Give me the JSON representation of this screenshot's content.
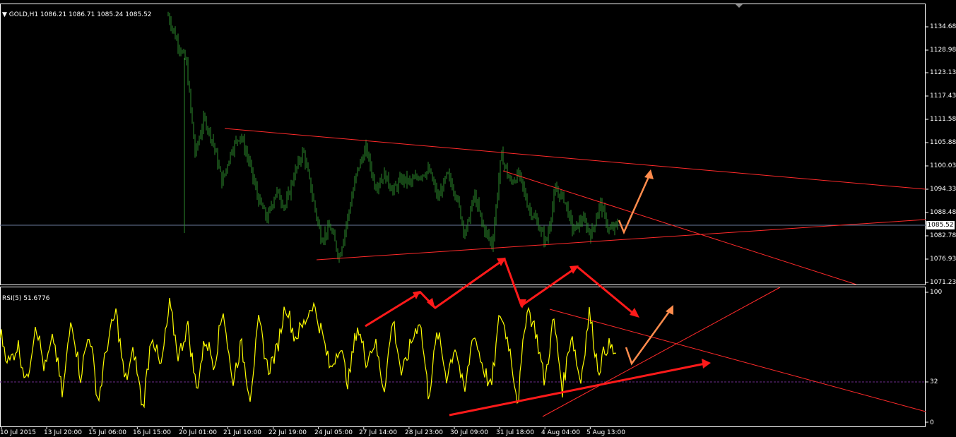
{
  "chart_header": {
    "symbol_caret": "▼",
    "symbol": "GOLD,H1",
    "ohlc": "1086.21 1086.71 1085.24 1085.52"
  },
  "rsi_header": {
    "label": "RSI(5) 51.6776"
  },
  "current_price": "1085.52",
  "price_axis": [
    "1134.68",
    "1128.98",
    "1123.13",
    "1117.43",
    "1111.58",
    "1105.88",
    "1100.03",
    "1094.33",
    "1088.48",
    "1082.78",
    "1076.93",
    "1071.23"
  ],
  "rsi_axis": [
    "100",
    "32",
    "0"
  ],
  "time_axis": [
    "10 Jul 2015",
    "13 Jul 20:00",
    "15 Jul 06:00",
    "16 Jul 15:00",
    "20 Jul 01:00",
    "21 Jul 10:00",
    "22 Jul 19:00",
    "24 Jul 05:00",
    "27 Jul 14:00",
    "28 Jul 23:00",
    "30 Jul 09:00",
    "31 Jul 18:00",
    "4 Aug 04:00",
    "5 Aug 13:00"
  ],
  "colors": {
    "background": "#000000",
    "frame": "#ffffff",
    "candle": "#2d8a2d",
    "trendline": "#ff2a2a",
    "arrow_red": "#ff1a1a",
    "arrow_orange": "#ff8c4d",
    "rsi_line": "#ffff00",
    "rsi_level": "#6b2d8a"
  },
  "chart_data": [
    {
      "type": "candlestick",
      "title": "GOLD,H1",
      "ylim": [
        1071.23,
        1137.5
      ],
      "x": [
        "10 Jul 2015",
        "13 Jul 20:00",
        "15 Jul 06:00",
        "16 Jul 15:00",
        "20 Jul 01:00",
        "21 Jul 10:00",
        "22 Jul 19:00",
        "24 Jul 05:00",
        "27 Jul 14:00",
        "28 Jul 23:00",
        "30 Jul 09:00",
        "31 Jul 18:00",
        "4 Aug 04:00",
        "5 Aug 13:00"
      ],
      "close_trace": [
        [
          0,
          1137.5
        ],
        [
          1,
          1131.0
        ],
        [
          2,
          1126.0
        ],
        [
          3,
          1103.0
        ],
        [
          4,
          1112.0
        ],
        [
          5,
          1106.0
        ],
        [
          6,
          1096.0
        ],
        [
          7,
          1104.0
        ],
        [
          8,
          1108.0
        ],
        [
          9,
          1101.0
        ],
        [
          10,
          1092.0
        ],
        [
          11,
          1087.0
        ],
        [
          12,
          1094.0
        ],
        [
          13,
          1090.0
        ],
        [
          14,
          1098.0
        ],
        [
          15,
          1104.0
        ],
        [
          16,
          1093.0
        ],
        [
          17,
          1082.0
        ],
        [
          18,
          1085.0
        ],
        [
          19,
          1077.5
        ],
        [
          20,
          1088.0
        ],
        [
          21,
          1099.0
        ],
        [
          22,
          1104.5
        ],
        [
          23,
          1095.0
        ],
        [
          24,
          1098.0
        ],
        [
          25,
          1094.0
        ],
        [
          26,
          1097.0
        ],
        [
          27,
          1096.0
        ],
        [
          28,
          1098.0
        ],
        [
          29,
          1099.0
        ],
        [
          30,
          1092.0
        ],
        [
          31,
          1098.0
        ],
        [
          32,
          1093.0
        ],
        [
          33,
          1083.0
        ],
        [
          34,
          1093.0
        ],
        [
          35,
          1085.0
        ],
        [
          36,
          1080.5
        ],
        [
          37,
          1103.0
        ],
        [
          38,
          1096.0
        ],
        [
          39,
          1098.0
        ],
        [
          40,
          1090.0
        ],
        [
          41,
          1086.0
        ],
        [
          42,
          1081.0
        ],
        [
          43,
          1094.0
        ],
        [
          44,
          1092.0
        ],
        [
          45,
          1084.0
        ],
        [
          46,
          1087.0
        ],
        [
          47,
          1083.0
        ],
        [
          48,
          1091.0
        ],
        [
          49,
          1084.0
        ],
        [
          50,
          1085.5
        ]
      ],
      "trendlines": [
        "upper resistance",
        "lower support",
        "short-term descending"
      ]
    },
    {
      "type": "line",
      "title": "RSI(5) 51.6776",
      "ylim": [
        0,
        100
      ],
      "levels": [
        32
      ],
      "series": [
        {
          "values": [
            70,
            45,
            60,
            30,
            78,
            40,
            65,
            20,
            82,
            35,
            70,
            15,
            60,
            85,
            30,
            55,
            10,
            70,
            40,
            90,
            50,
            75,
            25,
            65,
            45,
            88,
            30,
            60,
            20,
            78,
            40,
            55,
            92,
            65,
            75,
            92,
            70,
            40,
            60,
            30,
            75,
            48,
            62,
            25,
            80,
            35,
            60,
            80,
            20,
            70,
            35,
            60,
            20,
            70,
            45,
            25,
            85,
            60,
            15,
            90,
            70,
            30,
            80,
            25,
            70,
            30,
            85,
            40,
            60,
            52
          ]
        }
      ]
    }
  ]
}
